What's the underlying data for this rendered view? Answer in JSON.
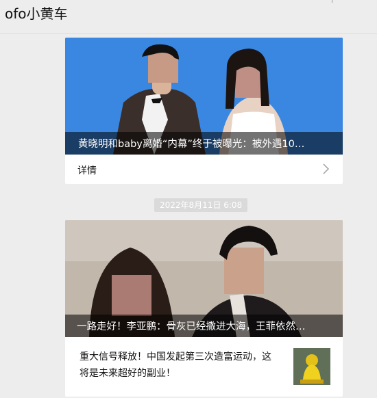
{
  "window": {
    "title": "ofo小黄车"
  },
  "feed": {
    "card1": {
      "headline": "黄晓明和baby离婚“内幕”终于被曝光：被外遇10…",
      "details_label": "详情"
    },
    "timestamp": "2022年8月11日  6:08",
    "card2": {
      "headline": "一路走好！李亚鹏：骨灰已经撒进大海，王菲依然…",
      "article_title": "重大信号释放！中国发起第三次造富运动，这将是未来超好的副业！"
    }
  },
  "colors": {
    "background": "#ededed",
    "card": "#ffffff",
    "timestamp_bg": "#dadada"
  }
}
